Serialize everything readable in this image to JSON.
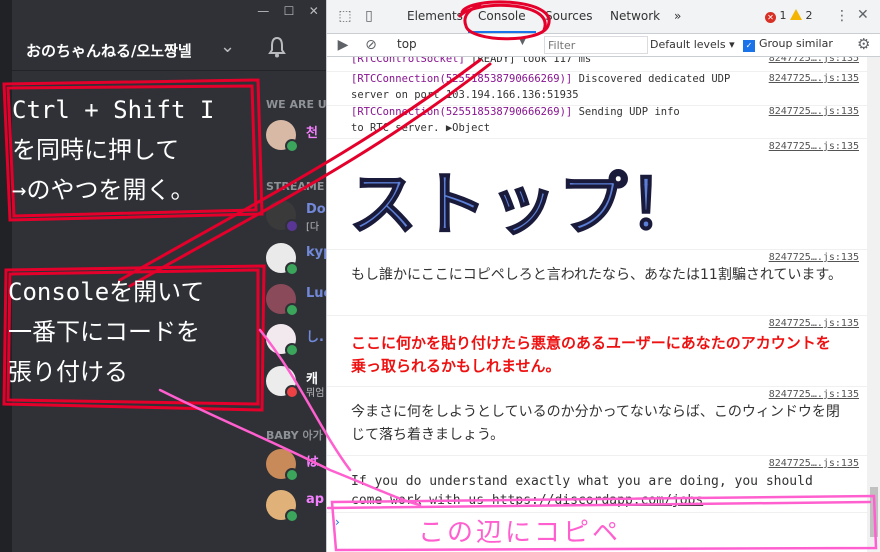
{
  "window": {
    "minimize": "—",
    "maximize": "☐",
    "close": "✕"
  },
  "server": {
    "name": "おのちゃんねる/오노짱넬"
  },
  "members": {
    "section_we_are": "WE ARE U",
    "section_streaming": "STREAME",
    "section_baby": "BABY 아가",
    "items": [
      {
        "name": "천",
        "sub": "",
        "color": "#f47fff",
        "status": "#3ba55c"
      },
      {
        "name": "Do",
        "sub": "[다",
        "color": "#7289da",
        "status": "#593695"
      },
      {
        "name": "kyp",
        "sub": "",
        "color": "#7289da",
        "status": "#3ba55c"
      },
      {
        "name": "Luc",
        "sub": "",
        "color": "#7289da",
        "status": "#3ba55c"
      },
      {
        "name": "し.",
        "sub": "",
        "color": "#7289da",
        "status": "#3ba55c"
      },
      {
        "name": "캐",
        "sub": "뭐엄",
        "color": "#ffffff",
        "status": "#ed4245"
      },
      {
        "name": "は",
        "sub": "",
        "color": "#f47fff",
        "status": "#3ba55c"
      },
      {
        "name": "ap",
        "sub": "",
        "color": "#f47fff",
        "status": "#3ba55c"
      }
    ]
  },
  "devtools": {
    "tabs": [
      "Elements",
      "Console",
      "Sources",
      "Network"
    ],
    "more_tabs": "»",
    "errors": "1",
    "warnings": "2",
    "context": "top",
    "filter_placeholder": "Filter",
    "levels": "Default levels",
    "group_similar": "Group similar"
  },
  "console": {
    "messages": [
      {
        "tag": "[RTCControlSocket]",
        "text": " [READY] took 117 ms",
        "src": "8247725….js:135"
      },
      {
        "tag": "[RTCConnection(525518538790666269)]",
        "text": " Discovered dedicated UDP server on port 103.194.166.136:51935",
        "src": "8247725….js:135"
      },
      {
        "tag": "[RTCConnection(525518538790666269)]",
        "text": " Sending UDP info to RTC server. ▶Object",
        "src": "8247725….js:135"
      }
    ],
    "stop_text": "ストップ！",
    "stop_src": "8247725….js:135",
    "warn1": "もし誰かにここにコピペしろと言われたなら、あなたは11割騙されています。",
    "warn1_src": "8247725….js:135",
    "warn2": "ここに何かを貼り付けたら悪意のあるユーザーにあなたのアカウントを乗っ取られるかもしれません。",
    "warn2_src": "8247725….js:135",
    "warn3": "今まさに何をしようとしているのか分かってないならば、このウィンドウを閉じて落ち着きましょう。",
    "warn3_src": "8247725….js:135",
    "en_text": "If you do understand exactly what you are doing, you should come work with us ",
    "en_link": "https://discordapp.com/jobs",
    "en_src": "8247725….js:135",
    "prompt": "›"
  },
  "annotations": {
    "shortcut_lines": [
      "Ctrl + Shift I",
      "を同時に押して",
      "→のやつを開く。"
    ],
    "console_lines": [
      "Consoleを開いて",
      "一番下にコードを",
      "張り付ける"
    ],
    "paste_here": "この辺にコピペ",
    "color": "#e4002b",
    "paste_color": "#ff5fcf"
  }
}
